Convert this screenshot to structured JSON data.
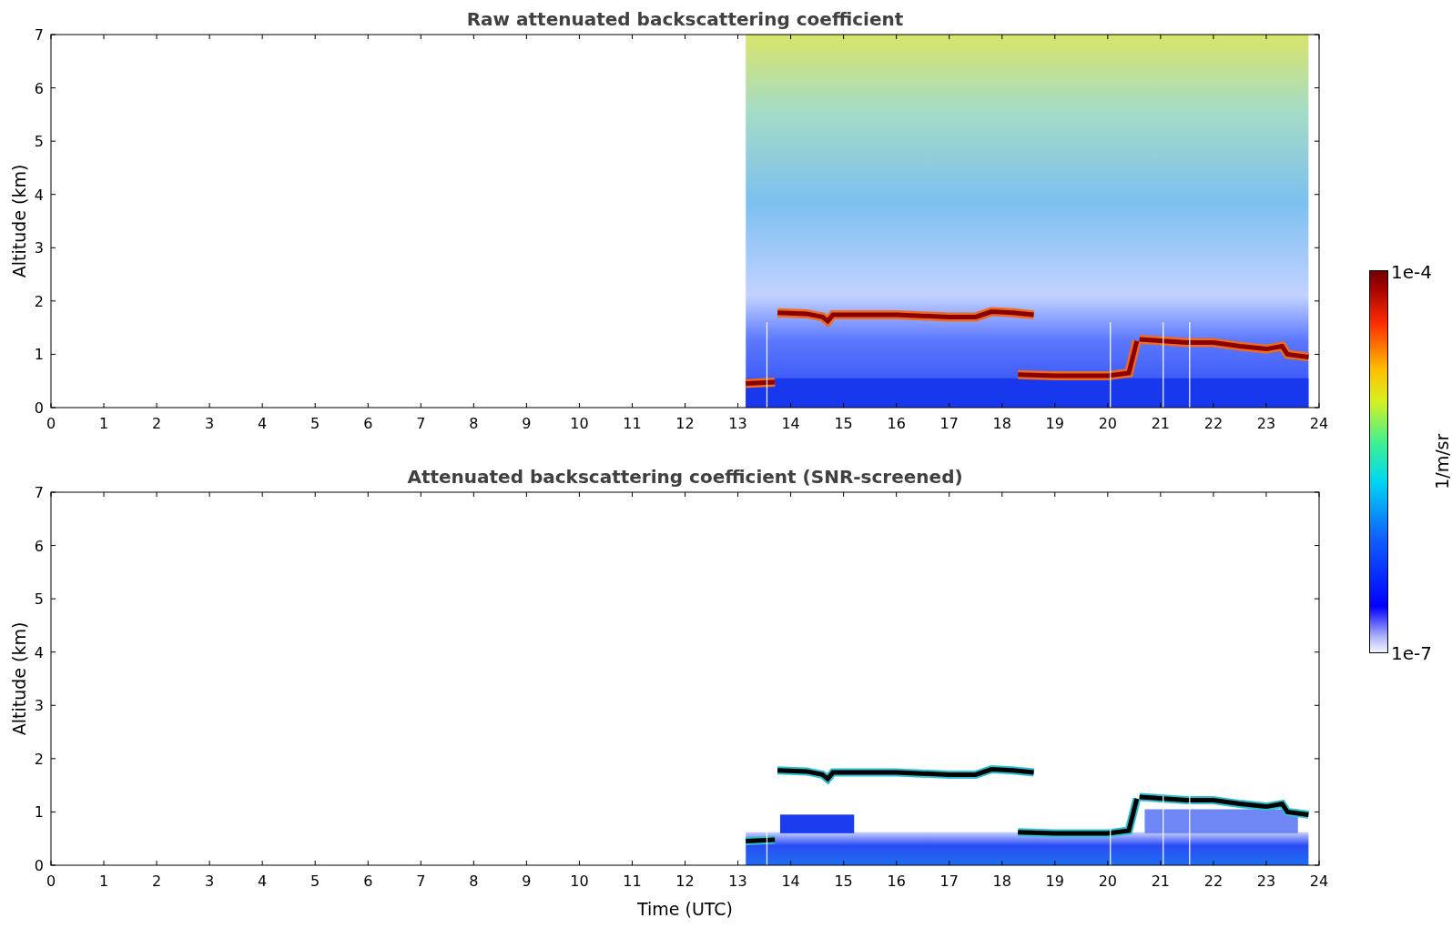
{
  "panels": [
    {
      "kind": "raw",
      "title": "Raw attenuated backscattering coefficient",
      "ylabel": "Altitude (km)",
      "yticks": [
        "7",
        "6",
        "5",
        "4",
        "3",
        "2",
        "1",
        "0"
      ],
      "xticks": [
        "0",
        "1",
        "2",
        "3",
        "4",
        "5",
        "6",
        "7",
        "8",
        "9",
        "10",
        "11",
        "12",
        "13",
        "14",
        "15",
        "16",
        "17",
        "18",
        "19",
        "20",
        "21",
        "22",
        "23",
        "24"
      ]
    },
    {
      "kind": "screened",
      "title": "Attenuated backscattering coefficient (SNR-screened)",
      "ylabel": "Altitude (km)",
      "yticks": [
        "7",
        "6",
        "5",
        "4",
        "3",
        "2",
        "1",
        "0"
      ],
      "xticks": [
        "0",
        "1",
        "2",
        "3",
        "4",
        "5",
        "6",
        "7",
        "8",
        "9",
        "10",
        "11",
        "12",
        "13",
        "14",
        "15",
        "16",
        "17",
        "18",
        "19",
        "20",
        "21",
        "22",
        "23",
        "24"
      ],
      "xlabel": "Time (UTC)"
    }
  ],
  "colorbar": {
    "max_label": "1e-4",
    "min_label": "1e-7",
    "unit_label": "1/m/sr"
  }
}
